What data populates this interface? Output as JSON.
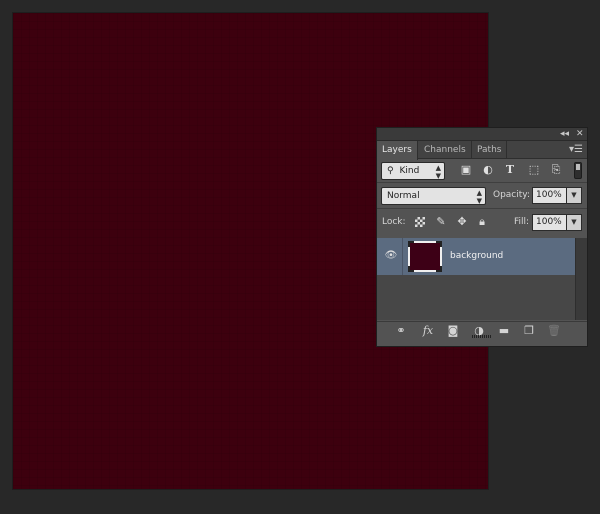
{
  "panel": {
    "titlebar": {
      "collapse_icon": "double-left-chevron-icon",
      "close_icon": "close-icon"
    },
    "tabs": [
      {
        "label": "Layers",
        "active": true
      },
      {
        "label": "Channels",
        "active": false
      },
      {
        "label": "Paths",
        "active": false
      }
    ],
    "menu_icon": "panel-menu-icon",
    "filter": {
      "kind_label": "Kind",
      "icons": [
        "pixel-layer-filter-icon",
        "adjustment-layer-filter-icon",
        "type-layer-filter-icon",
        "shape-layer-filter-icon",
        "smart-object-filter-icon"
      ]
    },
    "blend": {
      "mode": "Normal",
      "opacity_label": "Opacity:",
      "opacity": "100%"
    },
    "lock": {
      "label": "Lock:",
      "fill_label": "Fill:",
      "fill": "100%",
      "icons": [
        "lock-transparent-pixels-icon",
        "lock-image-pixels-icon",
        "lock-position-icon",
        "lock-all-icon"
      ]
    },
    "layers": [
      {
        "name": "background",
        "visible": true,
        "selected": true,
        "thumb_color": "#3d0016"
      }
    ],
    "bottom_icons": [
      "link-layers-icon",
      "fx-icon",
      "add-mask-icon",
      "adjustment-layer-icon",
      "new-group-icon",
      "new-layer-icon",
      "delete-layer-icon"
    ]
  },
  "colors": {
    "canvas": "#3d000e",
    "workspace": "#282828",
    "panel_bg": "#535353",
    "selected_row": "#5b6b80"
  }
}
